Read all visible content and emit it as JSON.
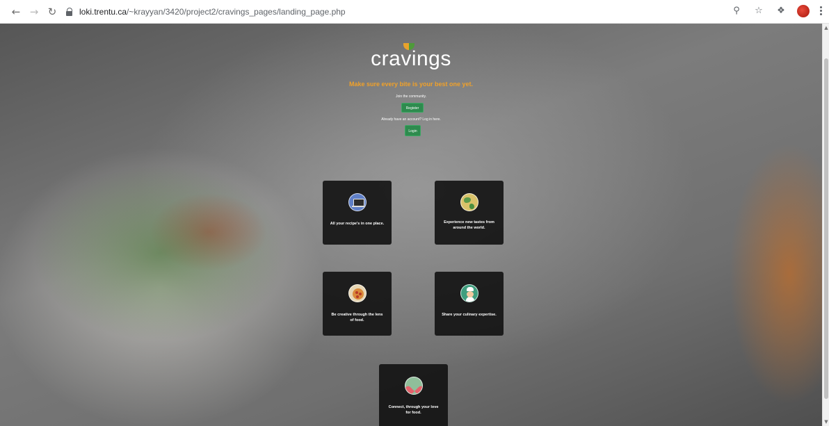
{
  "browser": {
    "url_host": "loki.trentu.ca",
    "url_path": "/~krayyan/3420/project2/cravings_pages/landing_page.php",
    "avatar_color": "#c7261a"
  },
  "header": {
    "logo_text": "cravings",
    "tagline": "Make sure every bite is your best one yet.",
    "accent_color": "#f0a12a"
  },
  "auth": {
    "join_text": "Join the community.",
    "register_label": "Register",
    "existing_text": "Already have an account? Log in here.",
    "login_label": "Login",
    "button_color": "#2e8b4e"
  },
  "features": [
    {
      "icon": "laptop-icon",
      "text": "All your recipe's in one place."
    },
    {
      "icon": "globe-icon",
      "text": "Experience new tastes from around the world."
    },
    {
      "icon": "pizza-icon",
      "text": "Be creative through the lens of food."
    },
    {
      "icon": "chef-icon",
      "text": "Share your culinary expertise."
    },
    {
      "icon": "heart-icon",
      "text": "Connect, through your love for food."
    }
  ]
}
